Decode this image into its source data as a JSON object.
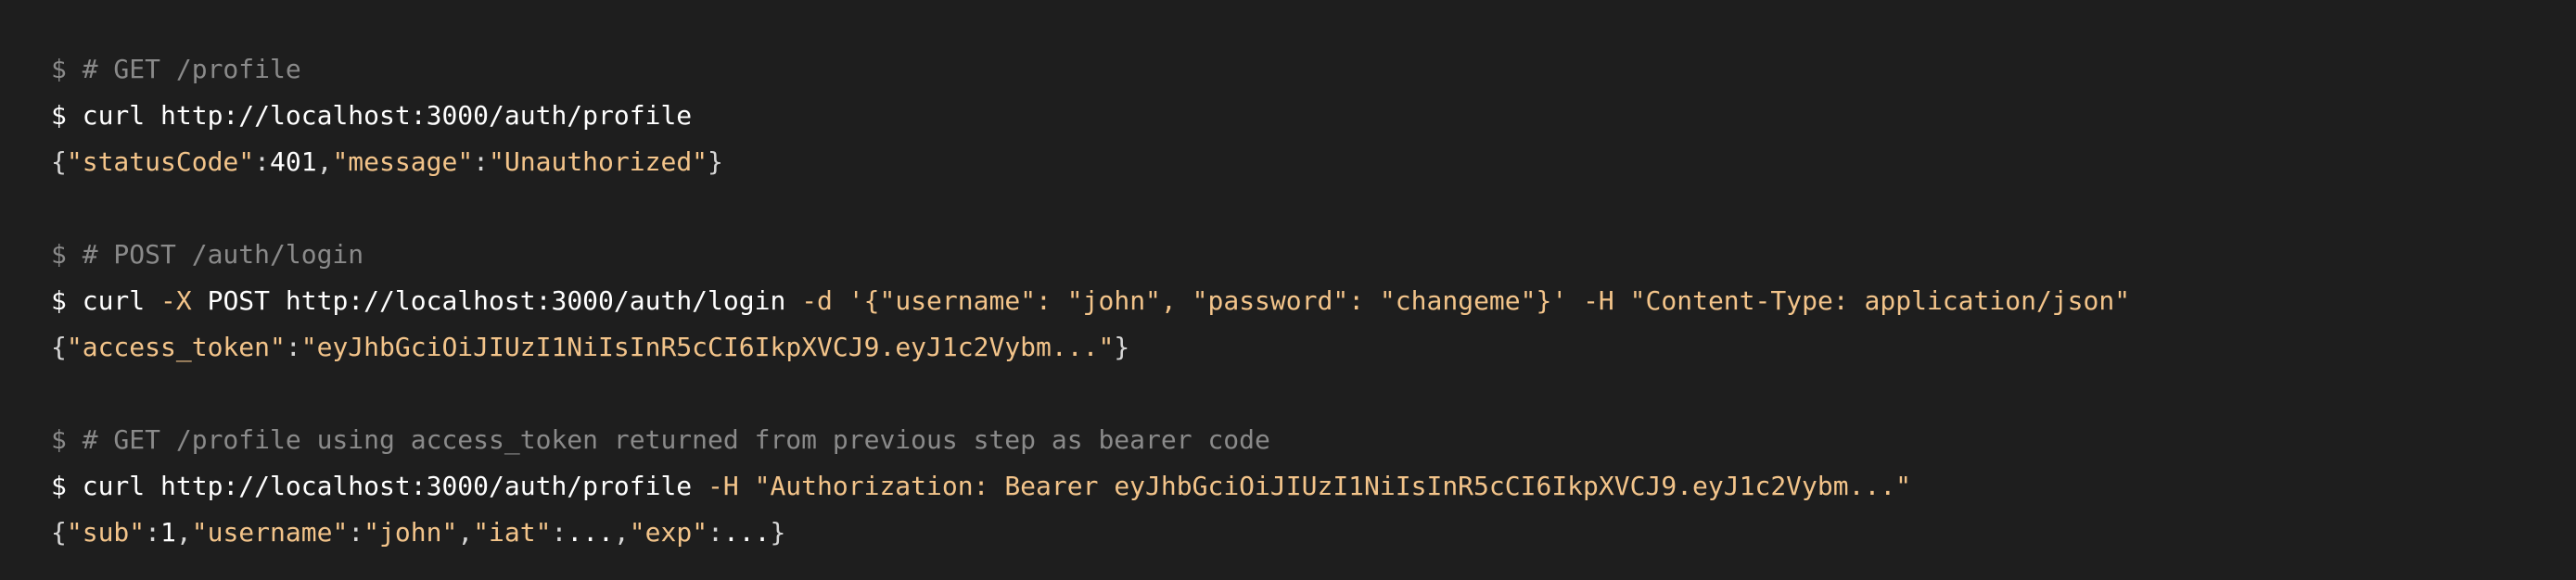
{
  "colors": {
    "background": "#1e1e1e",
    "command_text": "#ffffff",
    "comment_text": "#8a8a8a",
    "string_highlight": "#f3c48a",
    "punctuation": "#d6d6d6"
  },
  "blocks": [
    {
      "comment": "$ # GET /profile",
      "command": {
        "prompt": "$",
        "parts": [
          "curl http://localhost:3000/auth/profile"
        ]
      },
      "output": {
        "tokens": [
          "{",
          "\"statusCode\"",
          ":",
          "401",
          ",",
          "\"message\"",
          ":",
          "\"Unauthorized\"",
          "}"
        ]
      }
    },
    {
      "comment": "$ # POST /auth/login",
      "command": {
        "prompt": "$",
        "parts": [
          "curl ",
          "-X",
          " POST http://localhost:3000/auth/login ",
          "-d",
          " ",
          "'{\"username\": \"john\", \"password\": \"changeme\"}'",
          " ",
          "-H",
          " ",
          "\"Content-Type: application/json\""
        ]
      },
      "output": {
        "tokens": [
          "{",
          "\"access_token\"",
          ":",
          "\"eyJhbGciOiJIUzI1NiIsInR5cCI6IkpXVCJ9.eyJ1c2Vybm...\"",
          "}"
        ]
      }
    },
    {
      "comment": "$ # GET /profile using access_token returned from previous step as bearer code",
      "command": {
        "prompt": "$",
        "parts": [
          "curl http://localhost:3000/auth/profile ",
          "-H",
          " ",
          "\"Authorization: Bearer eyJhbGciOiJIUzI1NiIsInR5cCI6IkpXVCJ9.eyJ1c2Vybm...\""
        ]
      },
      "output": {
        "tokens": [
          "{",
          "\"sub\"",
          ":",
          "1",
          ",",
          "\"username\"",
          ":",
          "\"john\"",
          ",",
          "\"iat\"",
          ":",
          "...",
          ",",
          "\"exp\"",
          ":",
          "...",
          "}"
        ]
      }
    }
  ]
}
